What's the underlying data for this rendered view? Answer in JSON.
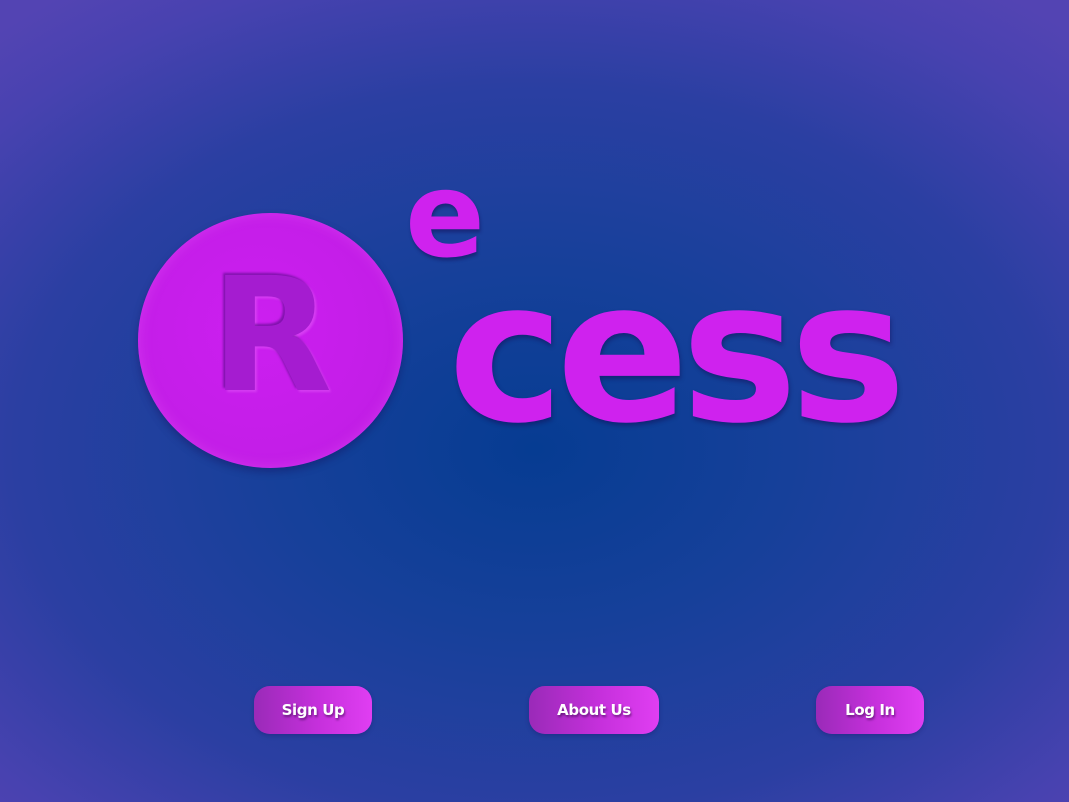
{
  "logo": {
    "circle_letter": "R",
    "superscript": "e",
    "word": "cess",
    "color": "#cf22ee"
  },
  "nav": {
    "signup_label": "Sign Up",
    "about_label": "About Us",
    "login_label": "Log In"
  },
  "colors": {
    "background_center": "#063c92",
    "background_edge": "#5344b3",
    "button_start": "#9a2ab8",
    "button_end": "#e03ef2"
  }
}
